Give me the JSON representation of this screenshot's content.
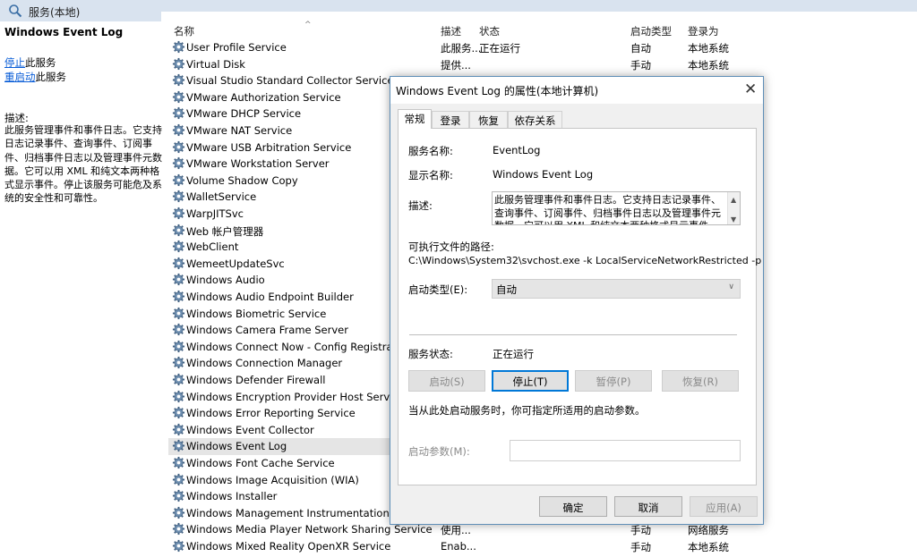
{
  "header": {
    "title": "服务(本地)"
  },
  "left": {
    "service_name": "Windows Event Log",
    "stop_link": "停止",
    "stop_suffix": "此服务",
    "restart_link": "重启动",
    "restart_suffix": "此服务",
    "desc_label": "描述:",
    "desc_text": "此服务管理事件和事件日志。它支持日志记录事件、查询事件、订阅事件、归档事件日志以及管理事件元数据。它可以用 XML 和纯文本两种格式显示事件。停止该服务可能危及系统的安全性和可靠性。"
  },
  "columns": {
    "name": "名称",
    "description": "描述",
    "status": "状态",
    "startup_type": "启动类型",
    "logon_as": "登录为"
  },
  "services": [
    {
      "name": "User Profile Service",
      "desc": "此服务...",
      "status": "正在运行",
      "startup": "自动",
      "logon": "本地系统"
    },
    {
      "name": "Virtual Disk",
      "desc": "提供...",
      "status": "",
      "startup": "手动",
      "logon": "本地系统"
    },
    {
      "name": "Visual Studio Standard Collector Service 150",
      "desc": "",
      "status": "",
      "startup": "",
      "logon": ""
    },
    {
      "name": "VMware Authorization Service",
      "desc": "",
      "status": "",
      "startup": "",
      "logon": ""
    },
    {
      "name": "VMware DHCP Service",
      "desc": "",
      "status": "",
      "startup": "",
      "logon": ""
    },
    {
      "name": "VMware NAT Service",
      "desc": "",
      "status": "",
      "startup": "",
      "logon": ""
    },
    {
      "name": "VMware USB Arbitration Service",
      "desc": "",
      "status": "",
      "startup": "",
      "logon": ""
    },
    {
      "name": "VMware Workstation Server",
      "desc": "",
      "status": "",
      "startup": "",
      "logon": ""
    },
    {
      "name": "Volume Shadow Copy",
      "desc": "",
      "status": "",
      "startup": "",
      "logon": ""
    },
    {
      "name": "WalletService",
      "desc": "",
      "status": "",
      "startup": "",
      "logon": ""
    },
    {
      "name": "WarpJITSvc",
      "desc": "",
      "status": "",
      "startup": "",
      "logon": ""
    },
    {
      "name": "Web 帐户管理器",
      "desc": "",
      "status": "",
      "startup": "",
      "logon": ""
    },
    {
      "name": "WebClient",
      "desc": "",
      "status": "",
      "startup": "",
      "logon": ""
    },
    {
      "name": "WemeetUpdateSvc",
      "desc": "",
      "status": "",
      "startup": "",
      "logon": ""
    },
    {
      "name": "Windows Audio",
      "desc": "",
      "status": "",
      "startup": "",
      "logon": ""
    },
    {
      "name": "Windows Audio Endpoint Builder",
      "desc": "",
      "status": "",
      "startup": "",
      "logon": ""
    },
    {
      "name": "Windows Biometric Service",
      "desc": "",
      "status": "",
      "startup": "",
      "logon": ""
    },
    {
      "name": "Windows Camera Frame Server",
      "desc": "",
      "status": "",
      "startup": "",
      "logon": ""
    },
    {
      "name": "Windows Connect Now - Config Registrar",
      "desc": "",
      "status": "",
      "startup": "",
      "logon": ""
    },
    {
      "name": "Windows Connection Manager",
      "desc": "",
      "status": "",
      "startup": "",
      "logon": ""
    },
    {
      "name": "Windows Defender Firewall",
      "desc": "",
      "status": "",
      "startup": "",
      "logon": ""
    },
    {
      "name": "Windows Encryption Provider Host Service",
      "desc": "",
      "status": "",
      "startup": "",
      "logon": ""
    },
    {
      "name": "Windows Error Reporting Service",
      "desc": "",
      "status": "",
      "startup": "",
      "logon": ""
    },
    {
      "name": "Windows Event Collector",
      "desc": "",
      "status": "",
      "startup": "",
      "logon": ""
    },
    {
      "name": "Windows Event Log",
      "desc": "",
      "status": "",
      "startup": "",
      "logon": "",
      "selected": true
    },
    {
      "name": "Windows Font Cache Service",
      "desc": "",
      "status": "",
      "startup": "",
      "logon": ""
    },
    {
      "name": "Windows Image Acquisition (WIA)",
      "desc": "",
      "status": "",
      "startup": "",
      "logon": ""
    },
    {
      "name": "Windows Installer",
      "desc": "",
      "status": "",
      "startup": "",
      "logon": ""
    },
    {
      "name": "Windows Management Instrumentation",
      "desc": "",
      "status": "",
      "startup": "",
      "logon": ""
    },
    {
      "name": "Windows Media Player Network Sharing Service",
      "desc": "使用...",
      "status": "",
      "startup": "手动",
      "logon": "网络服务"
    },
    {
      "name": "Windows Mixed Reality OpenXR Service",
      "desc": "Enab...",
      "status": "",
      "startup": "手动",
      "logon": "本地系统"
    }
  ],
  "dialog": {
    "title": "Windows Event Log 的属性(本地计算机)",
    "tabs": [
      "常规",
      "登录",
      "恢复",
      "依存关系"
    ],
    "service_name_label": "服务名称:",
    "service_name_value": "EventLog",
    "display_name_label": "显示名称:",
    "display_name_value": "Windows Event Log",
    "description_label": "描述:",
    "description_value": "此服务管理事件和事件日志。它支持日志记录事件、查询事件、订阅事件、归档事件日志以及管理事件元数据。它可以用 XML 和纯文本两种格式显示事件。停止该服务可能危及系统的安全性和可靠性。",
    "exe_path_label": "可执行文件的路径:",
    "exe_path_value": "C:\\Windows\\System32\\svchost.exe -k LocalServiceNetworkRestricted -p",
    "startup_type_label": "启动类型(E):",
    "startup_type_value": "自动",
    "service_status_label": "服务状态:",
    "service_status_value": "正在运行",
    "buttons": {
      "start": "启动(S)",
      "stop": "停止(T)",
      "pause": "暂停(P)",
      "resume": "恢复(R)"
    },
    "hint": "当从此处启动服务时，你可指定所适用的启动参数。",
    "param_label": "启动参数(M):",
    "param_value": "",
    "footer": {
      "ok": "确定",
      "cancel": "取消",
      "apply": "应用(A)"
    }
  }
}
